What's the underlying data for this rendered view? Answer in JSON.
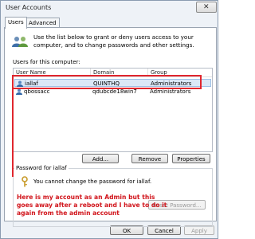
{
  "window": {
    "title": "User Accounts"
  },
  "tabs": [
    {
      "label": "Users"
    },
    {
      "label": "Advanced"
    }
  ],
  "intro": "Use the list below to grant or deny users access to your computer, and to change passwords and other settings.",
  "users_label": "Users for this computer:",
  "columns": {
    "user_name": "User Name",
    "domain": "Domain",
    "group": "Group"
  },
  "rows": [
    {
      "user": "iallaf",
      "domain": "QUINTHQ",
      "group": "Administrators",
      "selected": true
    },
    {
      "user": "qbossacc",
      "domain": "qdubcde18win7",
      "group": "Administrators",
      "selected": false
    }
  ],
  "buttons": {
    "add": "Add...",
    "remove": "Remove",
    "properties": "Properties",
    "reset": "Reset Password...",
    "ok": "OK",
    "cancel": "Cancel",
    "apply": "Apply"
  },
  "password_group": {
    "title": "Password for iallaf",
    "text": "You cannot change the password for iallaf."
  },
  "annotation": "Here is my account as an Admin but this goes away after a reboot and I have to do it again from the admin account",
  "colors": {
    "annotation": "#d1141b",
    "highlight_box": "#e0262e",
    "selection": "#dbe8f7"
  },
  "icons": {
    "users": "users-icon",
    "user_row": "user-icon",
    "key": "key-icon",
    "close": "close-icon"
  }
}
